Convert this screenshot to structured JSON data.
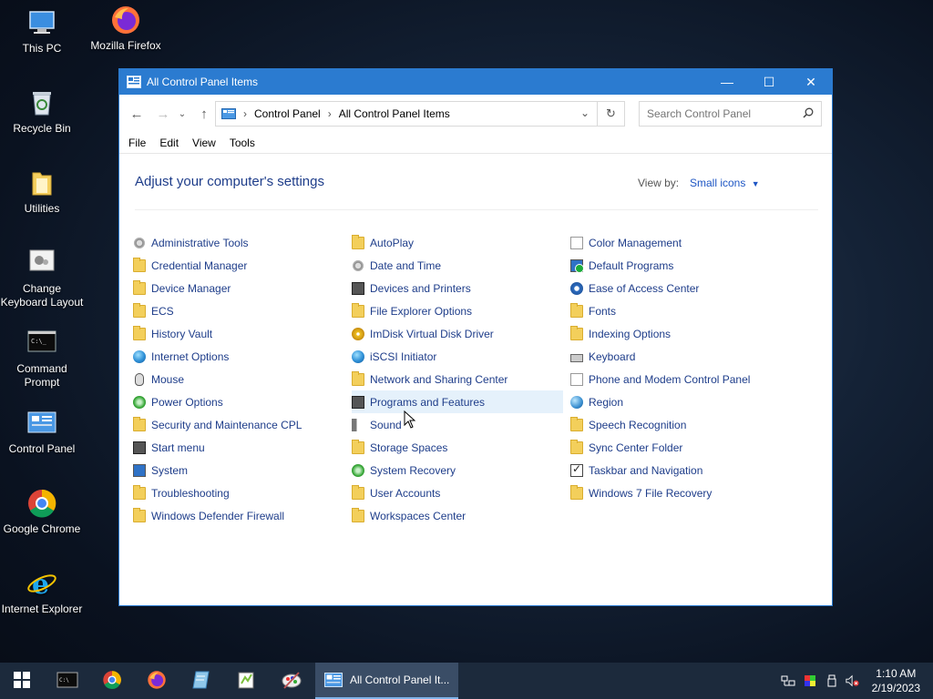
{
  "desktop": {
    "icons": [
      {
        "label": "This PC",
        "icon": "computer-icon"
      },
      {
        "label": "Mozilla Firefox",
        "icon": "firefox-icon"
      },
      {
        "label": "Recycle Bin",
        "icon": "recycle-bin-icon"
      },
      {
        "label": "Utilities",
        "icon": "folder-icon"
      },
      {
        "label": "Change Keyboard Layout",
        "icon": "keyboard-settings-icon"
      },
      {
        "label": "Command Prompt",
        "icon": "command-prompt-icon"
      },
      {
        "label": "Control Panel",
        "icon": "control-panel-icon"
      },
      {
        "label": "Google Chrome",
        "icon": "chrome-icon"
      },
      {
        "label": "Internet Explorer",
        "icon": "internet-explorer-icon"
      }
    ]
  },
  "window": {
    "title": "All Control Panel Items",
    "controls": {
      "minimize": "—",
      "maximize": "☐",
      "close": "✕"
    },
    "address": {
      "crumbs": [
        "Control Panel",
        "All Control Panel Items"
      ],
      "separator": "›",
      "search_placeholder": "Search Control Panel"
    },
    "menu": [
      "File",
      "Edit",
      "View",
      "Tools"
    ],
    "heading": "Adjust your computer's settings",
    "view_by_label": "View by:",
    "view_by_value": "Small icons",
    "columns": [
      [
        {
          "label": "Administrative Tools",
          "icon": "gear"
        },
        {
          "label": "Credential Manager",
          "icon": "folder"
        },
        {
          "label": "Device Manager",
          "icon": "folder"
        },
        {
          "label": "ECS",
          "icon": "folder"
        },
        {
          "label": "History Vault",
          "icon": "folder"
        },
        {
          "label": "Internet Options",
          "icon": "globe"
        },
        {
          "label": "Mouse",
          "icon": "mouse"
        },
        {
          "label": "Power Options",
          "icon": "recovery"
        },
        {
          "label": "Security and Maintenance CPL",
          "icon": "folder"
        },
        {
          "label": "Start menu",
          "icon": "dark"
        },
        {
          "label": "System",
          "icon": "monitor"
        },
        {
          "label": "Troubleshooting",
          "icon": "folder"
        },
        {
          "label": "Windows Defender Firewall",
          "icon": "folder"
        }
      ],
      [
        {
          "label": "AutoPlay",
          "icon": "folder"
        },
        {
          "label": "Date and Time",
          "icon": "gear"
        },
        {
          "label": "Devices and Printers",
          "icon": "dark"
        },
        {
          "label": "File Explorer Options",
          "icon": "folder"
        },
        {
          "label": "ImDisk Virtual Disk Driver",
          "icon": "cd"
        },
        {
          "label": "iSCSI Initiator",
          "icon": "globe"
        },
        {
          "label": "Network and Sharing Center",
          "icon": "folder"
        },
        {
          "label": "Programs and Features",
          "icon": "dark"
        },
        {
          "label": "Sound",
          "icon": "speaker"
        },
        {
          "label": "Storage Spaces",
          "icon": "folder"
        },
        {
          "label": "System Recovery",
          "icon": "recovery"
        },
        {
          "label": "User Accounts",
          "icon": "folder"
        },
        {
          "label": "Workspaces Center",
          "icon": "folder"
        }
      ],
      [
        {
          "label": "Color Management",
          "icon": "doc"
        },
        {
          "label": "Default Programs",
          "icon": "monitor greenbadge"
        },
        {
          "label": "Ease of Access Center",
          "icon": "access"
        },
        {
          "label": "Fonts",
          "icon": "folder"
        },
        {
          "label": "Indexing Options",
          "icon": "folder"
        },
        {
          "label": "Keyboard",
          "icon": "kbd"
        },
        {
          "label": "Phone and Modem Control Panel",
          "icon": "doc"
        },
        {
          "label": "Region",
          "icon": "region"
        },
        {
          "label": "Speech Recognition",
          "icon": "folder"
        },
        {
          "label": "Sync Center Folder",
          "icon": "folder"
        },
        {
          "label": "Taskbar and Navigation",
          "icon": "check"
        },
        {
          "label": "Windows 7 File Recovery",
          "icon": "folder"
        }
      ]
    ],
    "hovered_item": "Programs and Features"
  },
  "taskbar": {
    "pinned": [
      "command-prompt-icon",
      "chrome-icon",
      "firefox-icon",
      "notepad-icon",
      "notepad-plus-icon",
      "paint-icon"
    ],
    "active_window_label": "All Control Panel It...",
    "clock_time": "1:10 AM",
    "clock_date": "2/19/2023"
  }
}
